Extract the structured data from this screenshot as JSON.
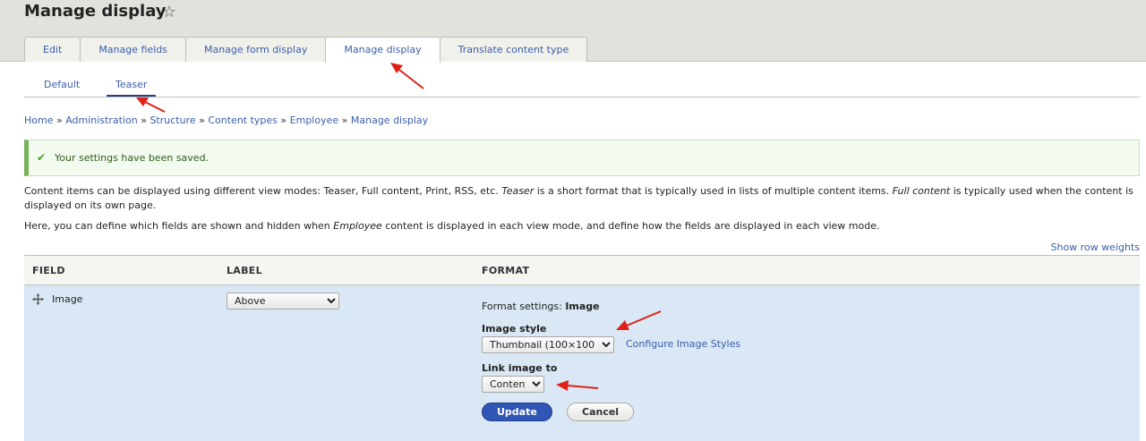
{
  "page": {
    "title": "Manage display"
  },
  "tabs": [
    {
      "label": "Edit"
    },
    {
      "label": "Manage fields"
    },
    {
      "label": "Manage form display"
    },
    {
      "label": "Manage display",
      "active": true
    },
    {
      "label": "Translate content type"
    }
  ],
  "subtabs": [
    {
      "label": "Default"
    },
    {
      "label": "Teaser",
      "active": true
    }
  ],
  "breadcrumb": {
    "items": [
      "Home",
      "Administration",
      "Structure",
      "Content types",
      "Employee",
      "Manage display"
    ],
    "separator": "»"
  },
  "message": {
    "text": "Your settings have been saved.",
    "icon": "check-icon"
  },
  "description": {
    "line1_a": "Content items can be displayed using different view modes: Teaser, Full content, Print, RSS, etc. ",
    "line1_em1": "Teaser",
    "line1_b": " is a short format that is typically used in lists of multiple content items. ",
    "line1_em2": "Full content",
    "line1_c": " is typically used when the content is displayed on its own page.",
    "line2_a": "Here, you can define which fields are shown and hidden when ",
    "line2_em": "Employee",
    "line2_b": " content is displayed in each view mode, and define how the fields are displayed in each view mode."
  },
  "row_weights_link": "Show row weights",
  "table": {
    "headers": {
      "field": "FIELD",
      "label": "LABEL",
      "format": "FORMAT"
    },
    "row": {
      "field": "Image",
      "label_value": "Above",
      "format_settings_prefix": "Format settings: ",
      "format_settings_name": "Image",
      "image_style_label": "Image style",
      "image_style_value": "Thumbnail (100×100)",
      "configure_link": "Configure Image Styles",
      "link_image_label": "Link image to",
      "link_image_value": "Content",
      "update_button": "Update",
      "cancel_button": "Cancel"
    }
  },
  "colors": {
    "link": "#3b5ea8",
    "primary_button": "#2f56b4",
    "status_ok": "#77b259",
    "row_highlight": "#d9e8f4",
    "annotation": "#e0211a"
  }
}
